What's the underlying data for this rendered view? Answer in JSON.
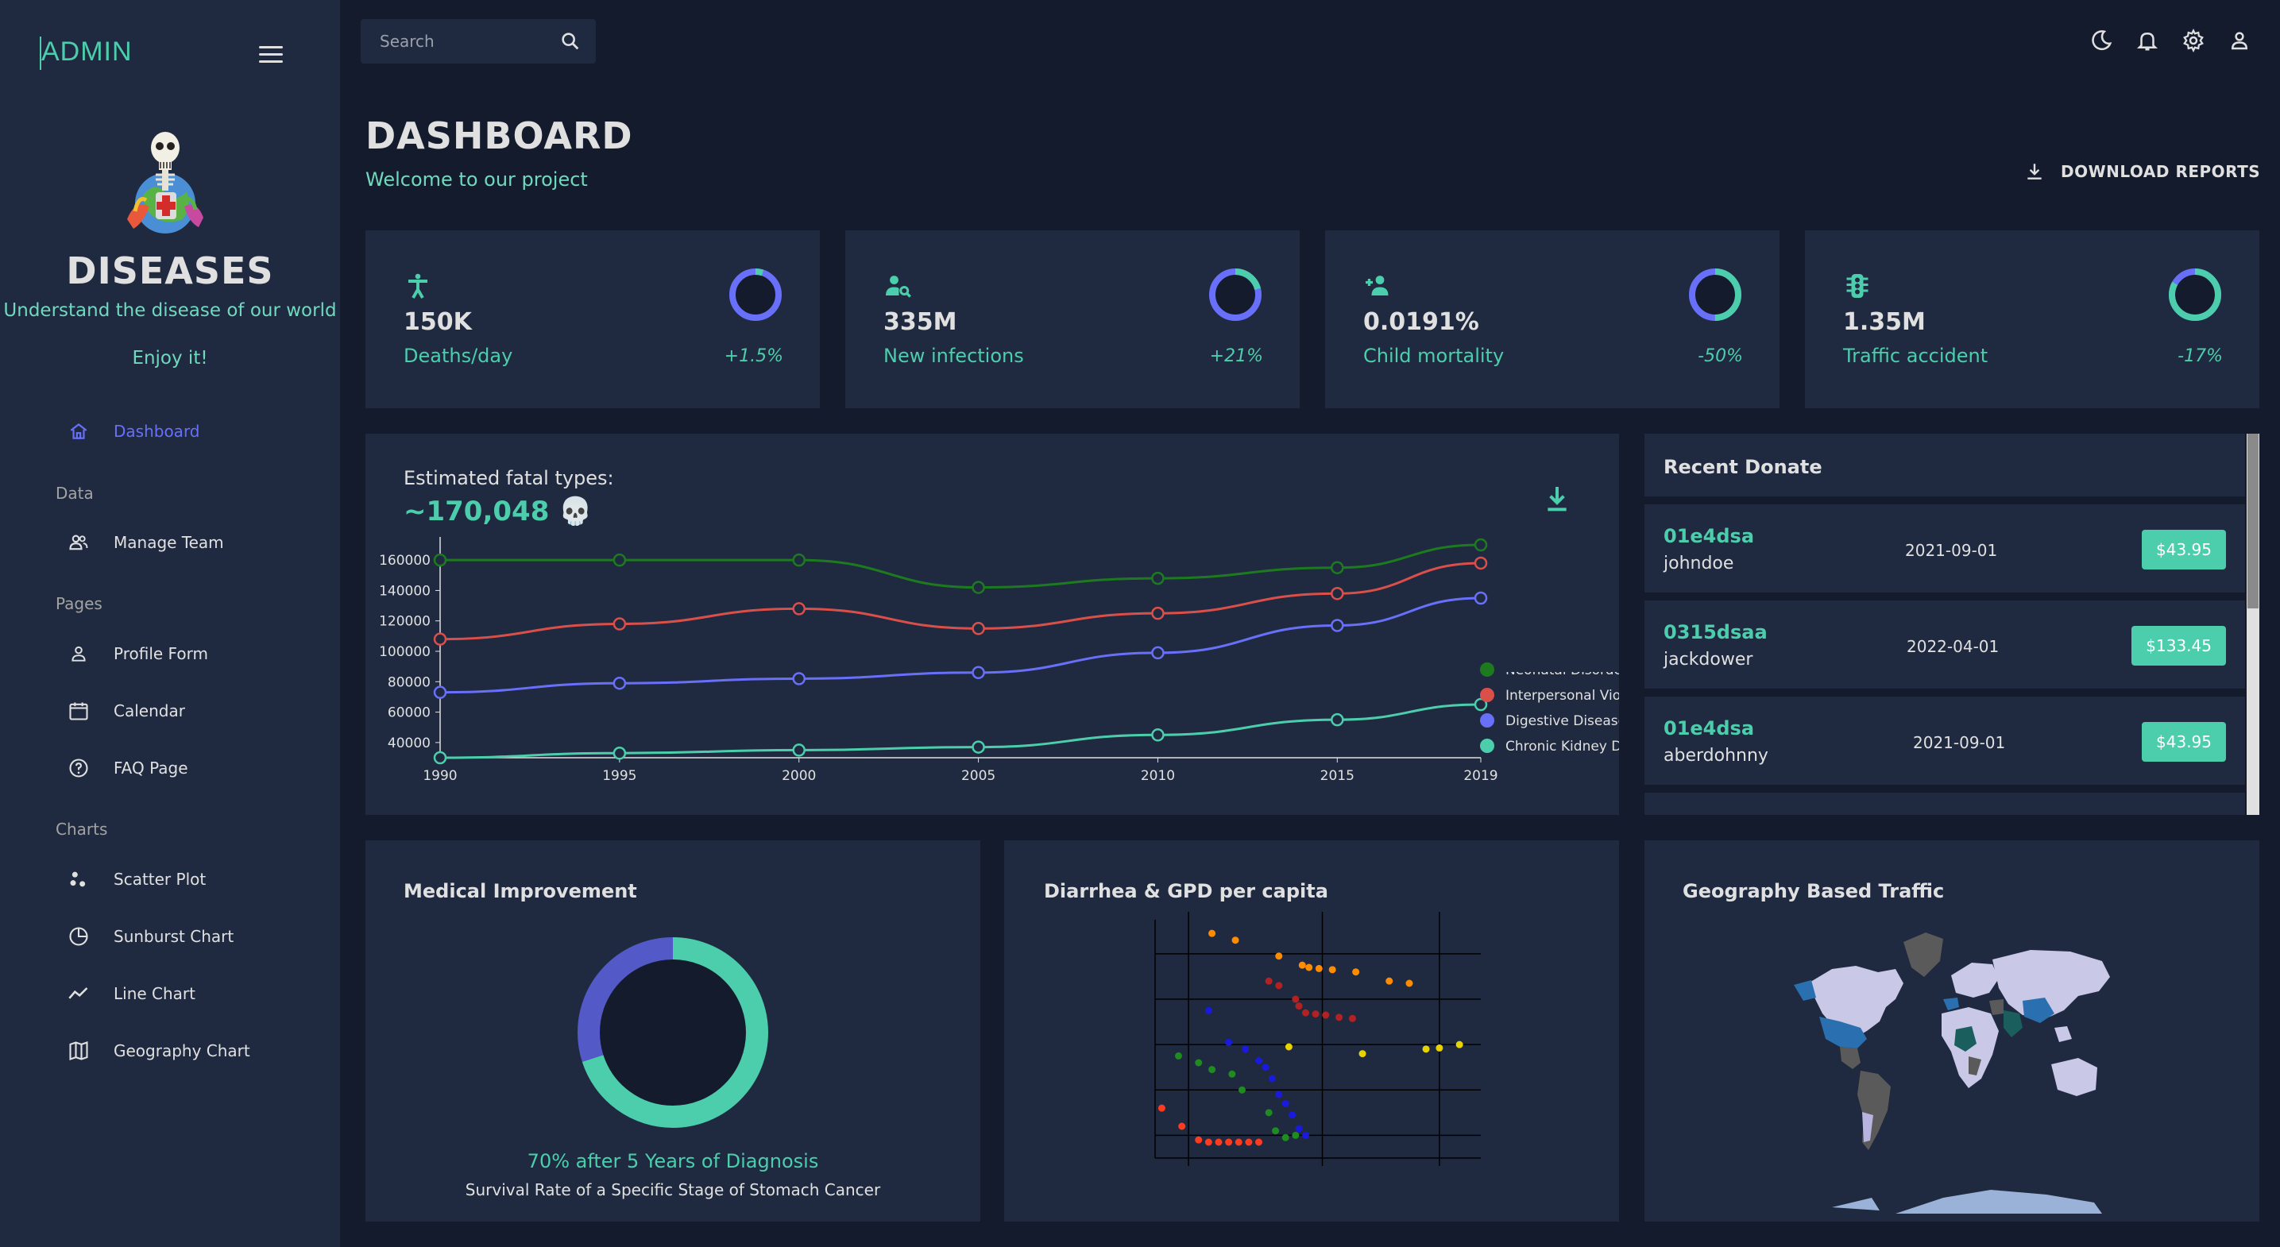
{
  "sidebar": {
    "app_title": "ADMIN",
    "brand_title": "DISEASES",
    "brand_subtitle": "Understand the disease of our world",
    "brand_tagline": "Enjoy it!",
    "items": [
      {
        "label": "Dashboard",
        "icon": "home-icon",
        "active": true
      },
      {
        "label": "Manage Team",
        "icon": "people-icon"
      },
      {
        "label": "Profile Form",
        "icon": "person-icon"
      },
      {
        "label": "Calendar",
        "icon": "calendar-icon"
      },
      {
        "label": "FAQ Page",
        "icon": "help-icon"
      },
      {
        "label": "Scatter Plot",
        "icon": "scatter-icon"
      },
      {
        "label": "Sunburst Chart",
        "icon": "pie-icon"
      },
      {
        "label": "Line Chart",
        "icon": "timeline-icon"
      },
      {
        "label": "Geography Chart",
        "icon": "map-icon"
      }
    ],
    "sections": [
      "Data",
      "Pages",
      "Charts"
    ]
  },
  "topbar": {
    "search_placeholder": "Search",
    "icons": [
      "dark-mode-icon",
      "notifications-icon",
      "settings-icon",
      "person-icon"
    ]
  },
  "header": {
    "title": "DASHBOARD",
    "subtitle": "Welcome to our project",
    "download_label": "DOWNLOAD REPORTS"
  },
  "stats": [
    {
      "value": "150K",
      "label": "Deaths/day",
      "change": "+1.5%",
      "progress": 0.05,
      "icon": "accessibility-icon"
    },
    {
      "value": "335M",
      "label": "New infections",
      "change": "+21%",
      "progress": 0.21,
      "icon": "person-search-icon"
    },
    {
      "value": "0.0191%",
      "label": "Child mortality",
      "change": "-50%",
      "progress": 0.5,
      "icon": "person-add-icon"
    },
    {
      "value": "1.35M",
      "label": "Traffic accident",
      "change": "-17%",
      "progress": 0.83,
      "icon": "traffic-icon"
    }
  ],
  "line_panel": {
    "title": "Estimated fatal types:",
    "total": "~170,048 💀"
  },
  "chart_data": [
    {
      "type": "line",
      "x": [
        1990,
        1995,
        2000,
        2005,
        2010,
        2015,
        2019
      ],
      "ylim": [
        30000,
        170000
      ],
      "yticks": [
        40000,
        60000,
        80000,
        100000,
        120000,
        140000,
        160000
      ],
      "legend_position": "right",
      "series": [
        {
          "name": "Neonatal Disorders",
          "color": "#1e7a1e",
          "values": [
            160000,
            160000,
            160000,
            142000,
            148000,
            155000,
            170000
          ]
        },
        {
          "name": "Interpersonal Violence",
          "color": "#db4f4a",
          "values": [
            108000,
            118000,
            128000,
            115000,
            125000,
            138000,
            158000
          ]
        },
        {
          "name": "Digestive Diseases",
          "color": "#6870fa",
          "values": [
            73000,
            79000,
            82000,
            86000,
            99000,
            117000,
            135000
          ]
        },
        {
          "name": "Chronic Kidney Diseases",
          "color": "#4cceac",
          "values": [
            30000,
            33000,
            35000,
            37000,
            45000,
            55000,
            65000
          ]
        }
      ],
      "legend_labels": [
        "Neonatal Disorders",
        "Interpersonal Violence",
        "Digestive Diseases",
        "Chronic Kidney Diseases"
      ]
    },
    {
      "type": "pie",
      "title": "Medical Improvement",
      "values": [
        70,
        30
      ],
      "colors": [
        "#4cceac",
        "#535ac8"
      ],
      "caption": "70% after 5 Years of Diagnosis",
      "subcaption": "Survival Rate of a Specific Stage of Stomach Cancer"
    },
    {
      "type": "scatter",
      "title": "Diarrhea & GPD per capita",
      "groups": [
        {
          "color": "#ff8c00",
          "points": [
            [
              1.2,
              9.9
            ],
            [
              1.9,
              9.6
            ],
            [
              3.2,
              8.9
            ],
            [
              3.9,
              8.5
            ],
            [
              4.1,
              8.4
            ],
            [
              4.4,
              8.35
            ],
            [
              4.8,
              8.3
            ],
            [
              5.5,
              8.2
            ],
            [
              6.5,
              7.8
            ],
            [
              7.1,
              7.7
            ]
          ]
        },
        {
          "color": "#b22222",
          "points": [
            [
              2.9,
              7.8
            ],
            [
              3.2,
              7.6
            ],
            [
              3.7,
              7.0
            ],
            [
              3.8,
              6.7
            ],
            [
              4.0,
              6.4
            ],
            [
              4.3,
              6.35
            ],
            [
              4.6,
              6.3
            ],
            [
              5.0,
              6.2
            ],
            [
              5.4,
              6.15
            ]
          ]
        },
        {
          "color": "#e8d200",
          "points": [
            [
              3.5,
              4.9
            ],
            [
              5.7,
              4.6
            ],
            [
              7.6,
              4.8
            ],
            [
              8.0,
              4.85
            ],
            [
              8.6,
              5.0
            ]
          ]
        },
        {
          "color": "#1a1adc",
          "points": [
            [
              1.1,
              6.5
            ],
            [
              1.7,
              5.1
            ],
            [
              2.2,
              4.8
            ],
            [
              2.6,
              4.3
            ],
            [
              2.8,
              4.0
            ],
            [
              3.0,
              3.5
            ],
            [
              3.2,
              2.8
            ],
            [
              3.4,
              2.4
            ],
            [
              3.6,
              1.9
            ],
            [
              3.8,
              1.3
            ],
            [
              4.0,
              1.0
            ]
          ]
        },
        {
          "color": "#1e8c1e",
          "points": [
            [
              0.2,
              4.5
            ],
            [
              0.8,
              4.2
            ],
            [
              1.2,
              3.9
            ],
            [
              1.8,
              3.7
            ],
            [
              2.1,
              3.0
            ],
            [
              2.9,
              2.0
            ],
            [
              3.1,
              1.2
            ],
            [
              3.4,
              0.9
            ],
            [
              3.7,
              1.0
            ]
          ]
        },
        {
          "color": "#ff3b1f",
          "points": [
            [
              -0.3,
              2.2
            ],
            [
              0.3,
              1.4
            ],
            [
              0.8,
              0.8
            ],
            [
              1.1,
              0.7
            ],
            [
              1.4,
              0.7
            ],
            [
              1.7,
              0.7
            ],
            [
              2.0,
              0.7
            ],
            [
              2.3,
              0.7
            ],
            [
              2.6,
              0.7
            ]
          ]
        }
      ]
    }
  ],
  "donations": {
    "title": "Recent Donate",
    "rows": [
      {
        "txid": "01e4dsa",
        "user": "johndoe",
        "date": "2021-09-01",
        "amount": "$43.95"
      },
      {
        "txid": "0315dsaa",
        "user": "jackdower",
        "date": "2022-04-01",
        "amount": "$133.45"
      },
      {
        "txid": "01e4dsa",
        "user": "aberdohnny",
        "date": "2021-09-01",
        "amount": "$43.95"
      }
    ]
  },
  "panels": {
    "medical_title": "Medical Improvement",
    "medical_caption": "70% after 5 Years of Diagnosis",
    "medical_subcaption": "Survival Rate of a Specific Stage of Stomach Cancer",
    "scatter_title": "Diarrhea & GPD per capita",
    "geo_title": "Geography Based Traffic"
  },
  "colors": {
    "background": "#141b2d",
    "panel": "#1f2a40",
    "accent": "#4cceac",
    "primary": "#6870fa",
    "text": "#e0e0e0"
  }
}
